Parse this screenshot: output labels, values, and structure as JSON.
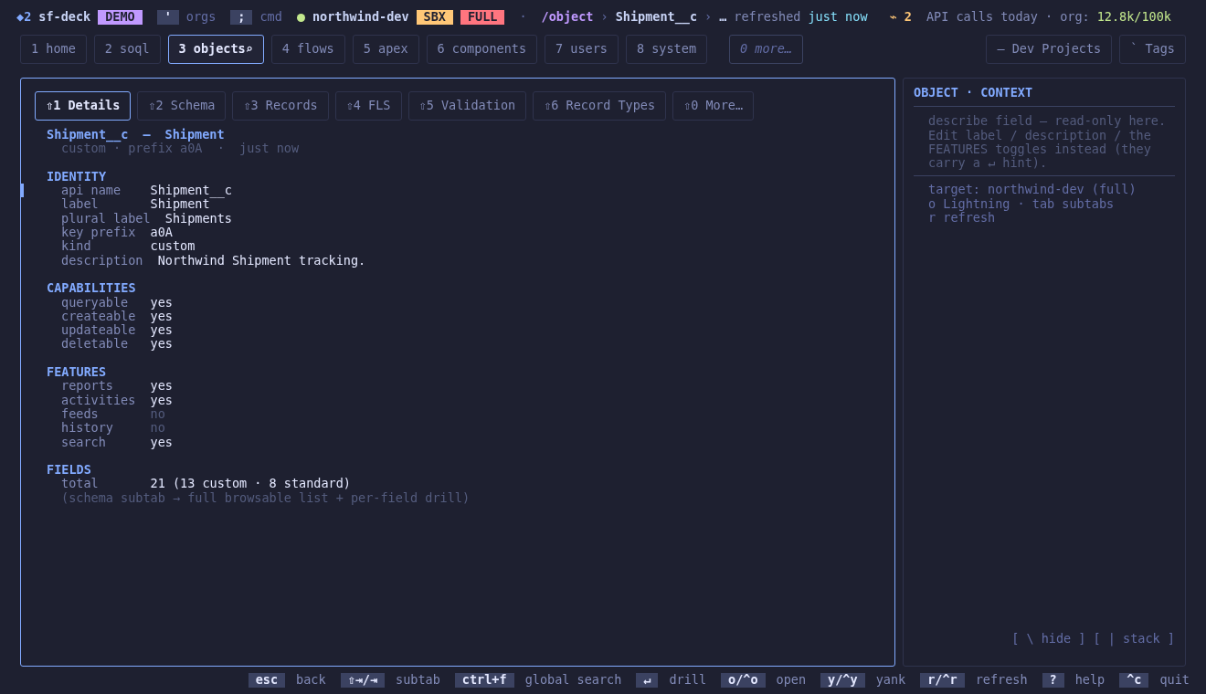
{
  "top_bar": {
    "brand": {
      "mark": "◆2",
      "name": "sf-deck",
      "badge": "DEMO"
    },
    "keys": [
      {
        "key": "'",
        "label": "orgs"
      },
      {
        "key": ";",
        "label": "cmd"
      }
    ],
    "org": {
      "color": "#c3e88d",
      "name": "northwind-dev",
      "tags": [
        {
          "text": "SBX",
          "color": "#ffc777"
        },
        {
          "text": "FULL",
          "color": "#ff757f"
        }
      ]
    },
    "separator": "·",
    "breadcrumb": [
      {
        "text": "/object",
        "kind": "root"
      },
      {
        "text": "›",
        "kind": "sep"
      },
      {
        "text": "Shipment__c",
        "kind": "item"
      },
      {
        "text": "›",
        "kind": "sep"
      },
      {
        "text": "…",
        "kind": "item"
      }
    ],
    "refreshed_label": "refreshed",
    "refreshed_value": "just now",
    "alerts": "⌁ 2",
    "api_label": "API calls today · org:",
    "api_value": "12.8k/100k"
  },
  "nav_tabs": [
    {
      "label": "1 home",
      "selected": false
    },
    {
      "label": "2 soql",
      "selected": false
    },
    {
      "label": "3 objects⌕",
      "selected": true
    },
    {
      "label": "4 flows",
      "selected": false
    },
    {
      "label": "5 apex",
      "selected": false
    },
    {
      "label": "6 components",
      "selected": false
    },
    {
      "label": "7 users",
      "selected": false
    },
    {
      "label": "8 system",
      "selected": false
    }
  ],
  "more_tab": "0 more…",
  "right_tabs": [
    "– Dev Projects",
    "` Tags"
  ],
  "subtabs": [
    {
      "label": "⇧1 Details",
      "selected": true
    },
    {
      "label": "⇧2 Schema",
      "selected": false
    },
    {
      "label": "⇧3 Records",
      "selected": false
    },
    {
      "label": "⇧4 FLS",
      "selected": false
    },
    {
      "label": "⇧5 Validation",
      "selected": false
    },
    {
      "label": "⇧6 Record Types",
      "selected": false
    },
    {
      "label": "⇧0 More…",
      "selected": false
    }
  ],
  "header": {
    "api_name": "Shipment__c",
    "dash": "—",
    "label": "Shipment",
    "meta": "custom · prefix a0A  ·  just now"
  },
  "sections": [
    {
      "heading": "IDENTITY",
      "rows": [
        {
          "key": "api name",
          "value": "Shipment__c",
          "dim": false,
          "selected": true
        },
        {
          "key": "label",
          "value": "Shipment",
          "dim": false,
          "selected": false
        },
        {
          "key": "plural label",
          "value": "Shipments",
          "dim": false,
          "selected": false
        },
        {
          "key": "key prefix",
          "value": "a0A",
          "dim": false,
          "selected": false
        },
        {
          "key": "kind",
          "value": "custom",
          "dim": false,
          "selected": false
        },
        {
          "key": "description",
          "value": "Northwind Shipment tracking.",
          "dim": false,
          "selected": false
        }
      ]
    },
    {
      "heading": "CAPABILITIES",
      "rows": [
        {
          "key": "queryable",
          "value": "yes",
          "dim": false,
          "selected": false
        },
        {
          "key": "createable",
          "value": "yes",
          "dim": false,
          "selected": false
        },
        {
          "key": "updateable",
          "value": "yes",
          "dim": false,
          "selected": false
        },
        {
          "key": "deletable",
          "value": "yes",
          "dim": false,
          "selected": false
        }
      ]
    },
    {
      "heading": "FEATURES",
      "rows": [
        {
          "key": "reports",
          "value": "yes",
          "dim": false,
          "selected": false
        },
        {
          "key": "activities",
          "value": "yes",
          "dim": false,
          "selected": false
        },
        {
          "key": "feeds",
          "value": "no",
          "dim": true,
          "selected": false
        },
        {
          "key": "history",
          "value": "no",
          "dim": true,
          "selected": false
        },
        {
          "key": "search",
          "value": "yes",
          "dim": false,
          "selected": false
        }
      ]
    },
    {
      "heading": "FIELDS",
      "rows": [
        {
          "key": "total",
          "value": "21 (13 custom · 8 standard)",
          "dim": false,
          "selected": false
        }
      ],
      "note": "(schema subtab → full browsable list + per-field drill)"
    }
  ],
  "side_panel": {
    "title": "OBJECT · CONTEXT",
    "description": "describe field — read-only here. Edit label / description / the FEATURES toggles instead (they carry a ↵ hint).",
    "lines": [
      "target: northwind-dev (full)",
      "o Lightning · tab subtabs",
      "r refresh"
    ],
    "footer": "[ \\ hide ] [ | stack ]"
  },
  "footer_keys": [
    {
      "key": "esc",
      "label": "back"
    },
    {
      "key": "⇧⇥/⇥",
      "label": "subtab"
    },
    {
      "key": "ctrl+f",
      "label": "global search"
    },
    {
      "key": "↵",
      "label": "drill"
    },
    {
      "key": "o/^o",
      "label": "open"
    },
    {
      "key": "y/^y",
      "label": "yank"
    },
    {
      "key": "r/^r",
      "label": "refresh"
    },
    {
      "key": "?",
      "label": "help"
    },
    {
      "key": "^c",
      "label": "quit"
    }
  ]
}
